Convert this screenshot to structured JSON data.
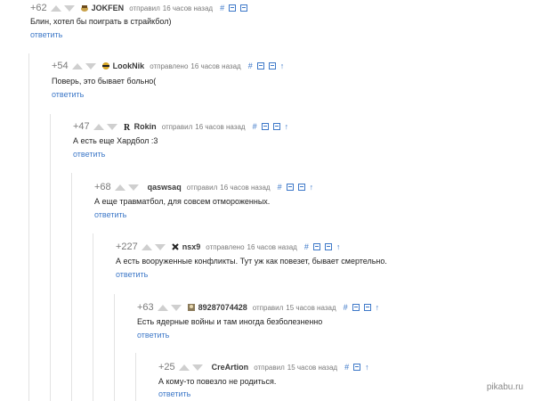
{
  "comments": [
    {
      "rating": "+62",
      "author": "JOKFEN",
      "action": "отправил",
      "time": "16 часов назад",
      "text": "Блин, хотел бы поиграть в страйкбол)",
      "reply": "ответить",
      "icons": [
        "hash-icon",
        "collapse-icon",
        "save-icon"
      ]
    },
    {
      "rating": "+54",
      "author": "LookNik",
      "action": "отправлено",
      "time": "16 часов назад",
      "text": "Поверь, это бывает больно(",
      "reply": "ответить",
      "icons": [
        "hash-icon",
        "collapse-icon",
        "save-icon",
        "parent-arrow-icon"
      ]
    },
    {
      "rating": "+47",
      "author": "Rokin",
      "action": "отправил",
      "time": "16 часов назад",
      "text": "А есть еще Хардбол :3",
      "reply": "ответить",
      "icons": [
        "hash-icon",
        "collapse-icon",
        "save-icon",
        "parent-arrow-icon"
      ]
    },
    {
      "rating": "+68",
      "author": "qaswsaq",
      "action": "отправил",
      "time": "16 часов назад",
      "text": "А еще травматбол, для совсем отмороженных.",
      "reply": "ответить",
      "icons": [
        "hash-icon",
        "collapse-icon",
        "save-icon",
        "parent-arrow-icon"
      ]
    },
    {
      "rating": "+227",
      "author": "nsx9",
      "action": "отправлено",
      "time": "16 часов назад",
      "text": "А есть вооруженные конфликты. Тут уж как повезет, бывает смертельно.",
      "reply": "ответить",
      "icons": [
        "hash-icon",
        "collapse-icon",
        "save-icon",
        "parent-arrow-icon"
      ]
    },
    {
      "rating": "+63",
      "author": "89287074428",
      "action": "отправил",
      "time": "15 часов назад",
      "text": "Есть ядерные войны и там иногда безболезненно",
      "reply": "ответить",
      "icons": [
        "hash-icon",
        "collapse-icon",
        "save-icon",
        "parent-arrow-icon"
      ]
    },
    {
      "rating": "+25",
      "author": "CreArtion",
      "action": "отправил",
      "time": "15 часов назад",
      "text": "А кому-то повезло не родиться.",
      "reply": "ответить",
      "icons": [
        "hash-icon",
        "save-icon",
        "parent-arrow-icon"
      ]
    }
  ],
  "glyphs": {
    "hash": "#",
    "up": "↑"
  },
  "watermark": "pikabu.ru",
  "colors": {
    "link": "#3d78c8",
    "thread_line": "#e3e3e3",
    "vote_arrow": "#cfcfcf"
  }
}
